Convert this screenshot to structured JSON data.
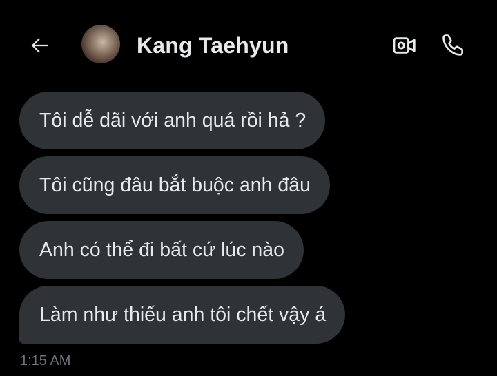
{
  "header": {
    "contact_name": "Kang Taehyun",
    "back_icon": "arrow-left-icon",
    "video_icon": "video-camera-icon",
    "call_icon": "phone-icon"
  },
  "messages": [
    {
      "text": "Tôi dễ dãi với anh quá rồi hả ?"
    },
    {
      "text": "Tôi cũng đâu bắt buộc anh đâu"
    },
    {
      "text": "Anh có thể đi bất cứ lúc nào"
    },
    {
      "text": "Làm như thiếu anh tôi chết vậy á"
    }
  ],
  "timestamp": "1:15 AM",
  "colors": {
    "background": "#000000",
    "bubble": "#2f3336",
    "text": "#e7e9ea",
    "muted": "#71767b"
  }
}
